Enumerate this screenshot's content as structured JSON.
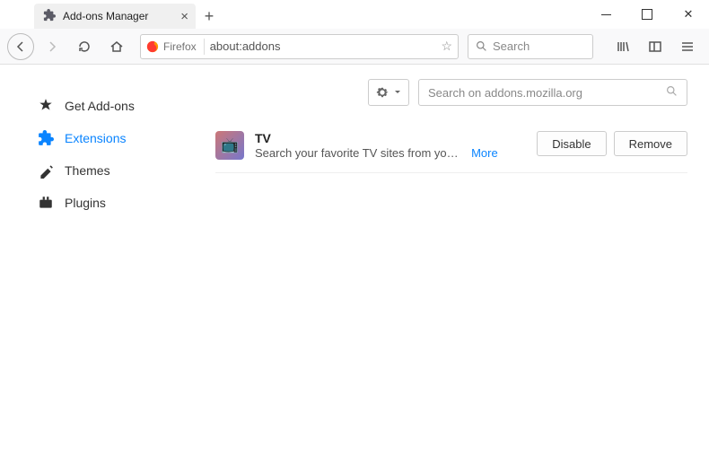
{
  "titlebar": {
    "tab_title": "Add-ons Manager",
    "tab_close": "×",
    "newtab": "+"
  },
  "toolbar": {
    "firefox_label": "Firefox",
    "url": "about:addons",
    "search_placeholder": "Search"
  },
  "sidebar": {
    "items": [
      {
        "label": "Get Add-ons"
      },
      {
        "label": "Extensions"
      },
      {
        "label": "Themes"
      },
      {
        "label": "Plugins"
      }
    ]
  },
  "main": {
    "amo_search_placeholder": "Search on addons.mozilla.org",
    "extension": {
      "name": "TV",
      "description": "Search your favorite TV sites from yo…",
      "more": "More",
      "disable": "Disable",
      "remove": "Remove"
    }
  }
}
